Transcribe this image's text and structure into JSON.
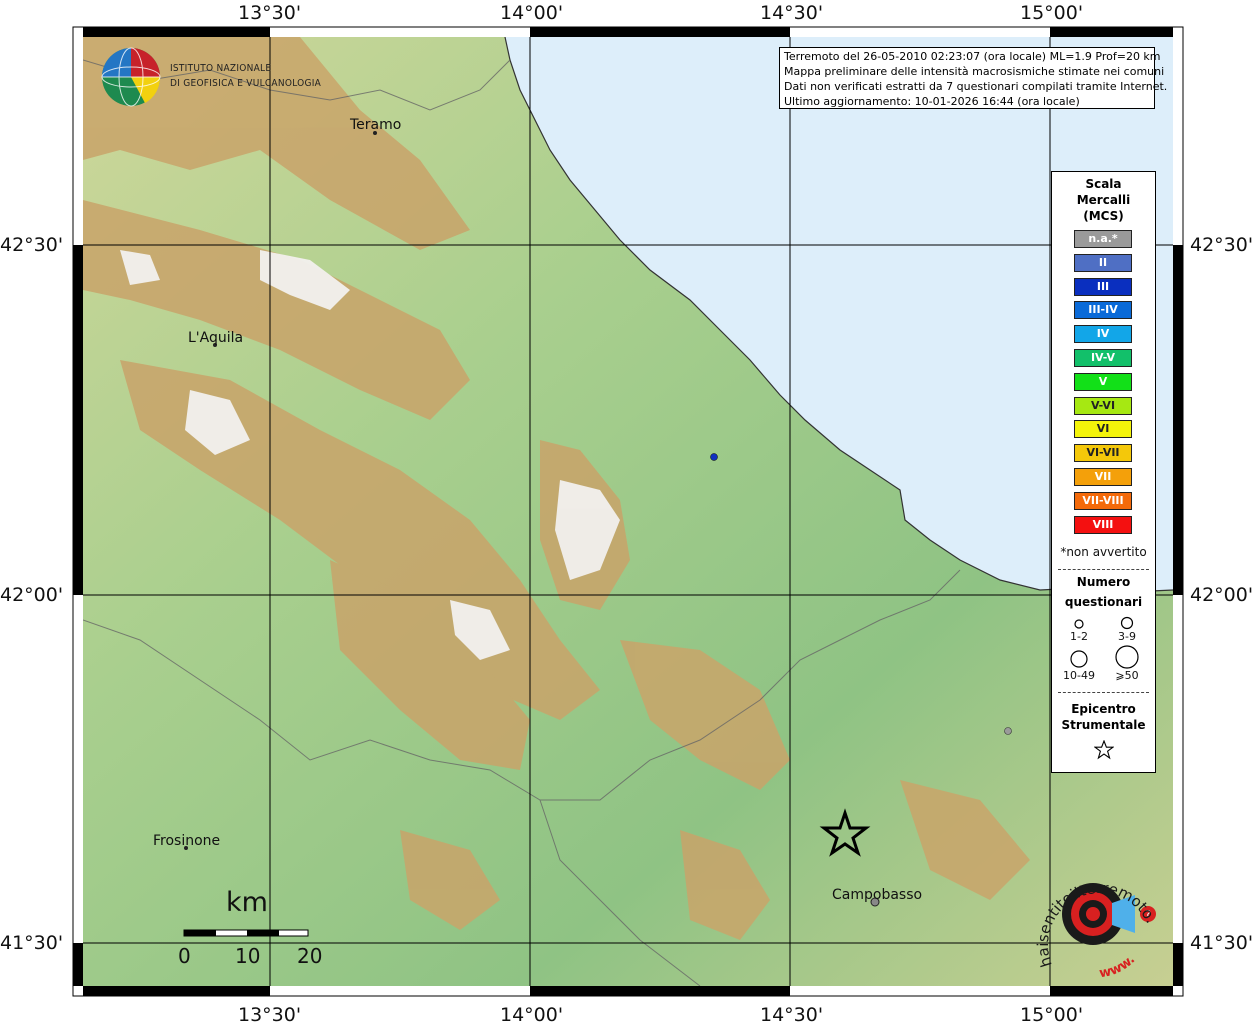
{
  "axis": {
    "lon_labels": [
      "13°30'",
      "14°00'",
      "14°30'",
      "15°00'"
    ],
    "lat_labels": [
      "42°30'",
      "42°00'",
      "41°30'"
    ]
  },
  "institute": {
    "line1": "ISTITUTO NAZIONALE",
    "line2": "DI GEOFISICA E VULCANOLOGIA"
  },
  "info": {
    "line1": "Terremoto del 26-05-2010 02:23:07 (ora locale) ML=1.9 Prof=20 km",
    "line2": "Mappa preliminare delle intensità macrosismiche stimate nei comuni",
    "line3": "Dati non verificati estratti da 7 questionari compilati tramite Internet.",
    "line4": "Ultimo aggiornamento: 10-01-2026 16:44 (ora locale)"
  },
  "cities": {
    "teramo": "Teramo",
    "laquila": "L'Aquila",
    "frosinone": "Frosinone",
    "campobasso": "Campobasso"
  },
  "legend": {
    "title1": "Scala",
    "title2": "Mercalli",
    "title3": "(MCS)",
    "classes": [
      {
        "label": "n.a.*",
        "color": "#9a9a9a"
      },
      {
        "label": "II",
        "color": "#4f6fc4"
      },
      {
        "label": "III",
        "color": "#0a2fbf"
      },
      {
        "label": "III-IV",
        "color": "#0a6ad8"
      },
      {
        "label": "IV",
        "color": "#12a6e8"
      },
      {
        "label": "IV-V",
        "color": "#12c06a"
      },
      {
        "label": "V",
        "color": "#12e018"
      },
      {
        "label": "V-VI",
        "color": "#a6e812"
      },
      {
        "label": "VI",
        "color": "#f4f40a"
      },
      {
        "label": "VI-VII",
        "color": "#f4c80a"
      },
      {
        "label": "VII",
        "color": "#f4a00a"
      },
      {
        "label": "VII-VIII",
        "color": "#f46a0a"
      },
      {
        "label": "VIII",
        "color": "#f41010"
      }
    ],
    "note": "*non avvertito",
    "questionnaires_title1": "Numero",
    "questionnaires_title2": "questionari",
    "q_labels": [
      "1-2",
      "3-9",
      "10-49",
      "⩾50"
    ],
    "epicenter_title1": "Epicentro",
    "epicenter_title2": "Strumentale"
  },
  "scalebar": {
    "unit": "km",
    "ticks": [
      "0",
      "10",
      "20"
    ]
  },
  "markers": {
    "point1_color": "#1030c0",
    "point2_color": "#9a9a9a",
    "epicenter_icon": "star-icon"
  },
  "logo": {
    "text": "haisentitoilterremoto.it",
    "prefix": "www.",
    "icon": "target-speaker-icon"
  }
}
